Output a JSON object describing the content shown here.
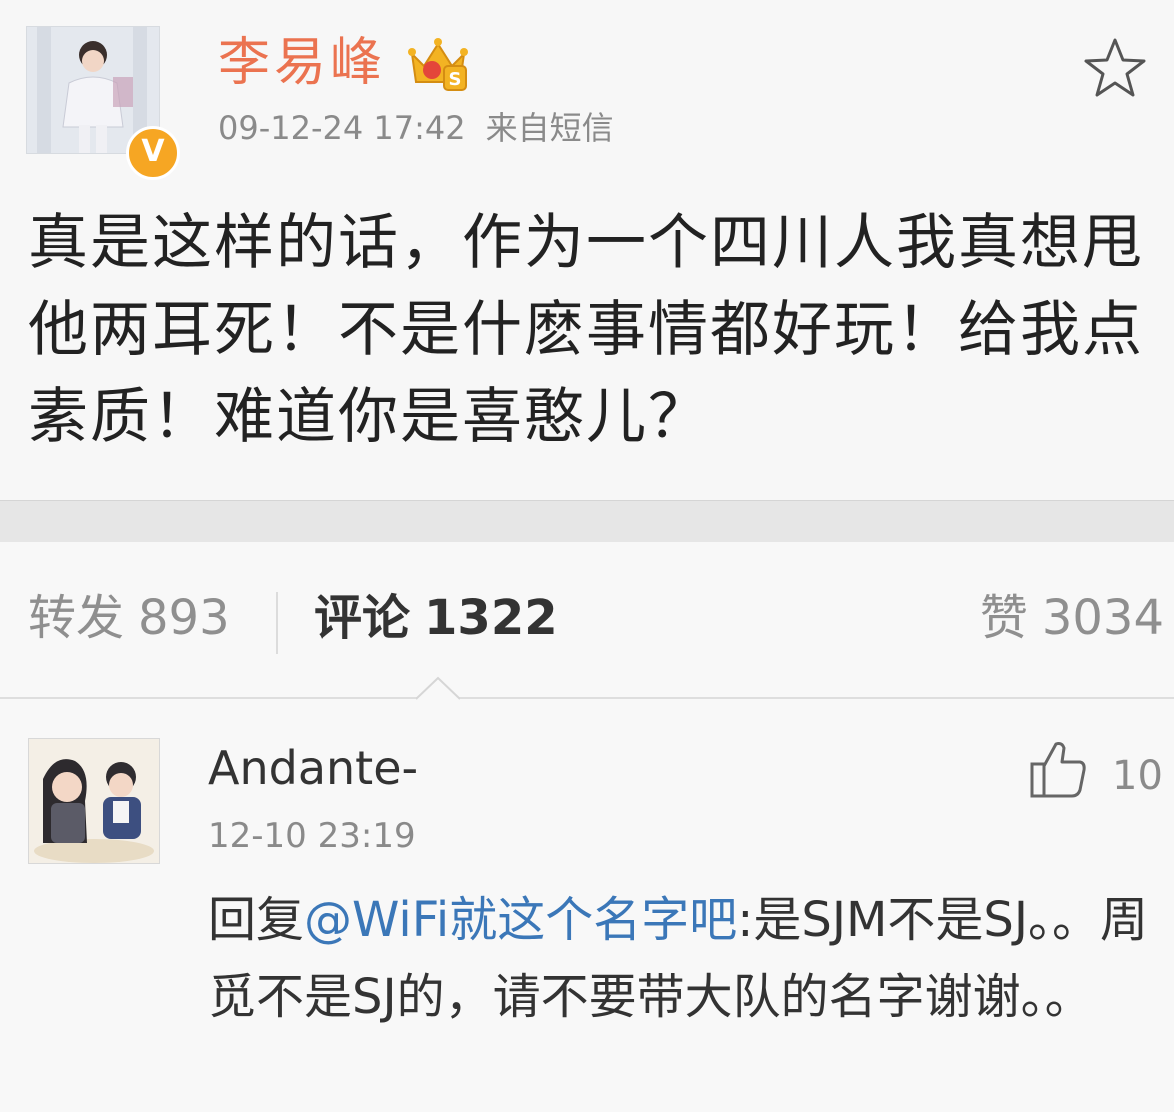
{
  "post": {
    "username": "李易峰",
    "timestamp": "09-12-24 17:42",
    "source": "来自短信",
    "text": "真是这样的话，作为一个四川人我真想甩他两耳死！不是什麽事情都好玩！给我点素质！难道你是喜憨儿？",
    "verified_badge": "V"
  },
  "stats": {
    "repost_label": "转发",
    "repost_count": "893",
    "comment_label": "评论",
    "comment_count": "1322",
    "like_label": "赞",
    "like_count": "3034"
  },
  "comment": {
    "username": "Andante-",
    "timestamp": "12-10 23:19",
    "like_count": "10",
    "reply_prefix": "回复",
    "mention": "@WiFi就这个名字吧",
    "text": ":是SJM不是SJ。。周觅不是SJ的，请不要带大队的名字谢谢。。"
  },
  "colors": {
    "username": "#eb7350",
    "mention": "#3b77b8",
    "verified": "#f6a623"
  },
  "icons": [
    "verified-icon",
    "crown-icon",
    "star-icon",
    "thumbs-up-icon"
  ]
}
